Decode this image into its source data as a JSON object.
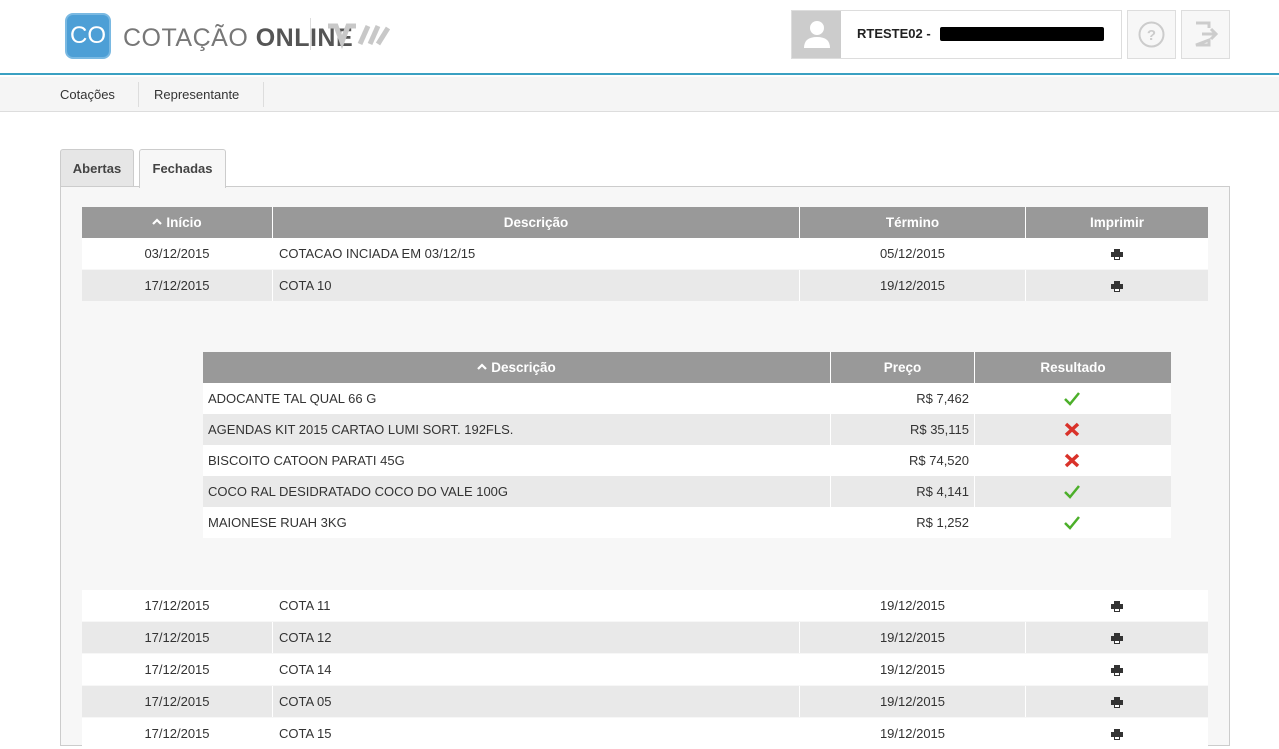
{
  "header": {
    "logo_badge": "CO",
    "logo_text_light": "COTAÇÃO",
    "logo_text_bold": "ONLINE",
    "user_name": "RTESTE02 -"
  },
  "nav": {
    "items": [
      "Cotações",
      "Representante"
    ]
  },
  "tabs": [
    "Abertas",
    "Fechadas"
  ],
  "main_table": {
    "headers": [
      "Início",
      "Descrição",
      "Término",
      "Imprimir"
    ],
    "rows_top": [
      {
        "inicio": "03/12/2015",
        "descricao": "COTACAO INCIADA EM 03/12/15",
        "termino": "05/12/2015"
      },
      {
        "inicio": "17/12/2015",
        "descricao": "COTA 10",
        "termino": "19/12/2015"
      }
    ],
    "rows_bottom": [
      {
        "inicio": "17/12/2015",
        "descricao": "COTA 11",
        "termino": "19/12/2015"
      },
      {
        "inicio": "17/12/2015",
        "descricao": "COTA 12",
        "termino": "19/12/2015"
      },
      {
        "inicio": "17/12/2015",
        "descricao": "COTA 14",
        "termino": "19/12/2015"
      },
      {
        "inicio": "17/12/2015",
        "descricao": "COTA 05",
        "termino": "19/12/2015"
      },
      {
        "inicio": "17/12/2015",
        "descricao": "COTA 15",
        "termino": "19/12/2015"
      }
    ]
  },
  "sub_table": {
    "headers": [
      "Descrição",
      "Preço",
      "Resultado"
    ],
    "rows": [
      {
        "descricao": "ADOCANTE TAL QUAL 66 G",
        "preco": "R$ 7,462",
        "resultado": "ok"
      },
      {
        "descricao": "AGENDAS KIT 2015 CARTAO LUMI SORT. 192FLS.",
        "preco": "R$ 35,115",
        "resultado": "fail"
      },
      {
        "descricao": "BISCOITO CATOON PARATI 45G",
        "preco": "R$ 74,520",
        "resultado": "fail"
      },
      {
        "descricao": "COCO RAL DESIDRATADO COCO DO VALE 100G",
        "preco": "R$ 4,141",
        "resultado": "ok"
      },
      {
        "descricao": "MAIONESE RUAH 3KG",
        "preco": "R$ 1,252",
        "resultado": "ok"
      }
    ]
  },
  "colors": {
    "accent": "#3aa0c2",
    "header_gray": "#999999",
    "ok_green": "#4caf2a",
    "fail_red": "#d9322a"
  }
}
